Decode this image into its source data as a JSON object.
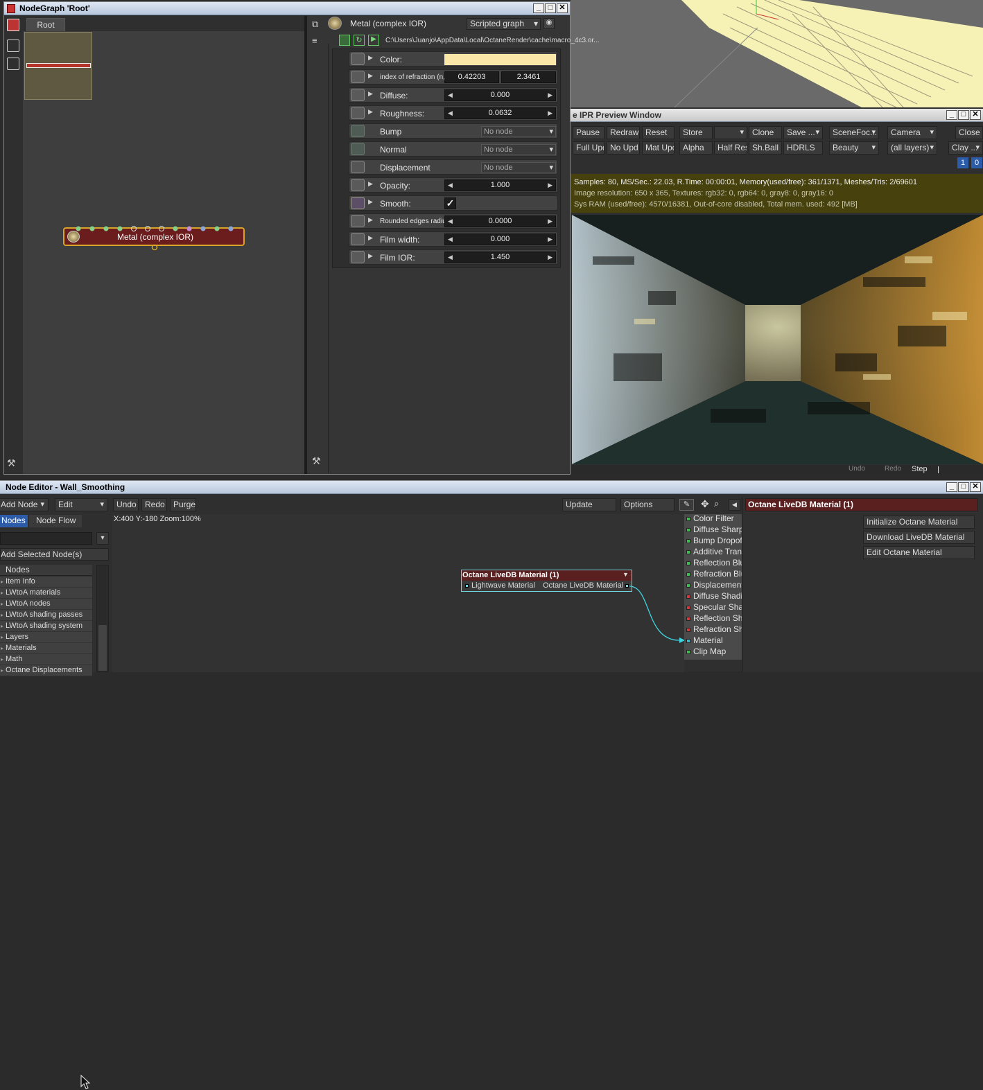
{
  "nodegraph": {
    "title": "NodeGraph 'Root'",
    "tab": "Root",
    "node_label": "Metal (complex IOR)",
    "header_title": "Metal (complex IOR)",
    "graph_select": "Scripted graph",
    "path": "C:\\Users\\Juanjo\\AppData\\Local\\OctaneRender\\cache\\macro_4c3.or...",
    "params": [
      {
        "label": "Color:"
      },
      {
        "label": "index of refraction (n, k):",
        "v1": "0.42203",
        "v2": "2.3461"
      },
      {
        "label": "Diffuse:",
        "value": "0.000"
      },
      {
        "label": "Roughness:",
        "value": "0.0632"
      },
      {
        "label": "Bump",
        "value": "No node"
      },
      {
        "label": "Normal",
        "value": "No node"
      },
      {
        "label": "Displacement",
        "value": "No node"
      },
      {
        "label": "Opacity:",
        "value": "1.000"
      },
      {
        "label": "Smooth:",
        "value": "✓"
      },
      {
        "label": "Rounded edges radius:",
        "value": "0.0000"
      },
      {
        "label": "Film width:",
        "value": "0.000"
      },
      {
        "label": "Film IOR:",
        "value": "1.450"
      }
    ],
    "color_value": "#fbe7a8"
  },
  "ipr": {
    "title": "e IPR Preview Window",
    "row1": [
      "Pause",
      "Redraw",
      "Reset",
      "Store",
      "",
      "Clone",
      "Save ...",
      "SceneFoc...",
      "Camera",
      "Close"
    ],
    "row2": [
      "Full Upd.",
      "No Upd.",
      "Mat Upd",
      "Alpha",
      "Half Res",
      "Sh.Ball",
      "HDRLS",
      "Beauty",
      "(all layers)",
      "Clay ..."
    ],
    "badges": [
      "1",
      "0"
    ],
    "stats": [
      "Samples: 80, MS/Sec.: 22.03, R.Time: 00:00:01, Memory(used/free): 361/1371, Meshes/Tris: 2/69601",
      "Image resolution: 650 x 365, Textures:  rgb32: 0, rgb64: 0, gray8: 0, gray16: 0",
      "Sys RAM (used/free): 4570/16381, Out-of-core disabled, Total mem. used: 492  [MB]"
    ],
    "bottom": [
      "Undo",
      "Redo",
      "Step"
    ]
  },
  "node_editor": {
    "title": "Node Editor - Wall_Smoothing",
    "toolbar": {
      "add_node": "Add Node",
      "edit": "Edit",
      "undo": "Undo",
      "redo": "Redo",
      "purge": "Purge",
      "update": "Update",
      "options": "Options"
    },
    "tabs": [
      "Nodes",
      "Node Flow"
    ],
    "add_selected": "Add Selected Node(s)",
    "tree_header": "Nodes",
    "tree": [
      "Item Info",
      "LWtoA materials",
      "LWtoA nodes",
      "LWtoA shading passes",
      "LWtoA shading system",
      "Layers",
      "Materials",
      "Math",
      "Octane Displacements"
    ],
    "coords": "X:400 Y:-180 Zoom:100%",
    "node_title": "Octane LiveDB Material (1)",
    "node_in": "Lightwave Material",
    "node_out": "Octane LiveDB Material",
    "ports": [
      {
        "label": "Color Filter",
        "color": "#3fbf4f"
      },
      {
        "label": "Diffuse Sharpness",
        "color": "#3fbf4f"
      },
      {
        "label": "Bump Dropoff",
        "color": "#3fbf4f"
      },
      {
        "label": "Additive Transparency",
        "color": "#3fbf4f"
      },
      {
        "label": "Reflection Blur",
        "color": "#3fbf4f"
      },
      {
        "label": "Refraction Blur",
        "color": "#3fbf4f"
      },
      {
        "label": "Displacement",
        "color": "#3fbf4f"
      },
      {
        "label": "Diffuse Shading",
        "color": "#d03a3a"
      },
      {
        "label": "Specular Shading",
        "color": "#d03a3a"
      },
      {
        "label": "Reflection Shading",
        "color": "#d03a3a"
      },
      {
        "label": "Refraction Shading",
        "color": "#d03a3a"
      },
      {
        "label": "Material",
        "color": "#3fb6c4"
      },
      {
        "label": "Clip Map",
        "color": "#3fbf4f"
      }
    ],
    "panel_title": "Octane LiveDB Material (1)",
    "panel_buttons": [
      "Initialize Octane Material",
      "Download LiveDB Material",
      "Edit Octane Material"
    ]
  }
}
